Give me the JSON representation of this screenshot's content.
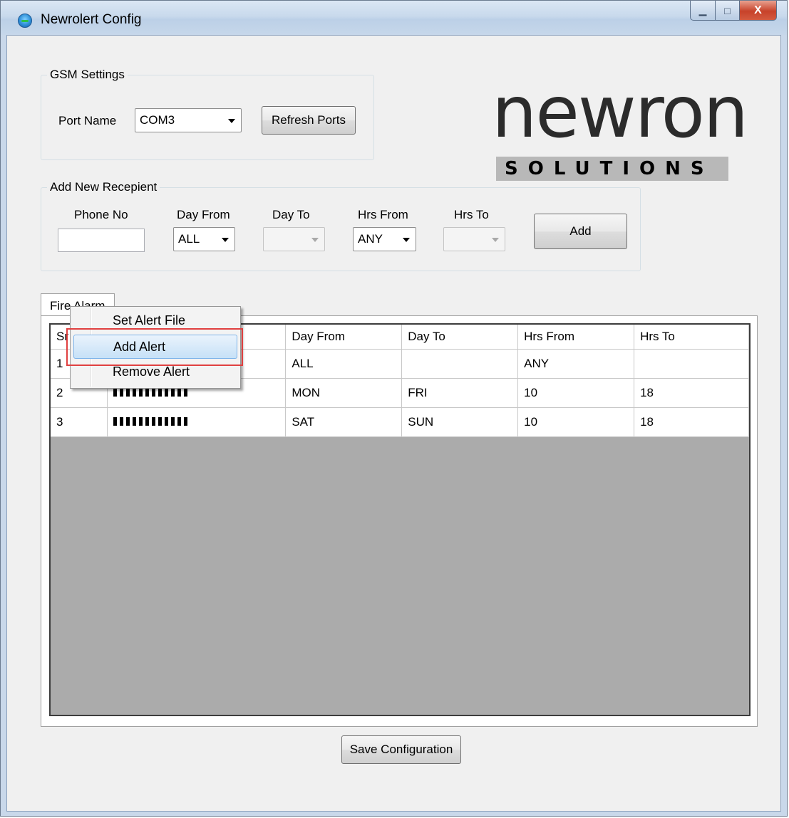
{
  "window": {
    "title": "Newrolert Config",
    "min_glyph": "▁",
    "max_glyph": "□",
    "close_glyph": "X"
  },
  "gsm": {
    "title": "GSM Settings",
    "port_label": "Port Name",
    "port_value": "COM3",
    "refresh_label": "Refresh Ports"
  },
  "logo": {
    "word": "newron",
    "sub": "SOLUTIONS"
  },
  "recipient": {
    "title": "Add New Recepient",
    "phone_label": "Phone No",
    "phone_value": "",
    "day_from_label": "Day From",
    "day_from_value": "ALL",
    "day_to_label": "Day To",
    "day_to_value": "",
    "hrs_from_label": "Hrs From",
    "hrs_from_value": "ANY",
    "hrs_to_label": "Hrs To",
    "hrs_to_value": "",
    "add_label": "Add"
  },
  "tabs": [
    {
      "label": "Fire Alarm"
    }
  ],
  "grid": {
    "columns": [
      "Sr",
      "",
      "Day From",
      "Day To",
      "Hrs From",
      "Hrs To"
    ],
    "rows": [
      {
        "sr": "1",
        "day_from": "ALL",
        "day_to": "",
        "hrs_from": "ANY",
        "hrs_to": ""
      },
      {
        "sr": "2",
        "day_from": "MON",
        "day_to": "FRI",
        "hrs_from": "10",
        "hrs_to": "18"
      },
      {
        "sr": "3",
        "day_from": "SAT",
        "day_to": "SUN",
        "hrs_from": "10",
        "hrs_to": "18"
      }
    ]
  },
  "context_menu": {
    "items": [
      "Set Alert File",
      "Add Alert",
      "Remove Alert"
    ],
    "selected": "Add Alert"
  },
  "footer": {
    "save_label": "Save Configuration"
  },
  "colors": {
    "highlight": "#e04040",
    "grid_bg": "#ababab",
    "menu_selected": "#c6e1f7"
  }
}
